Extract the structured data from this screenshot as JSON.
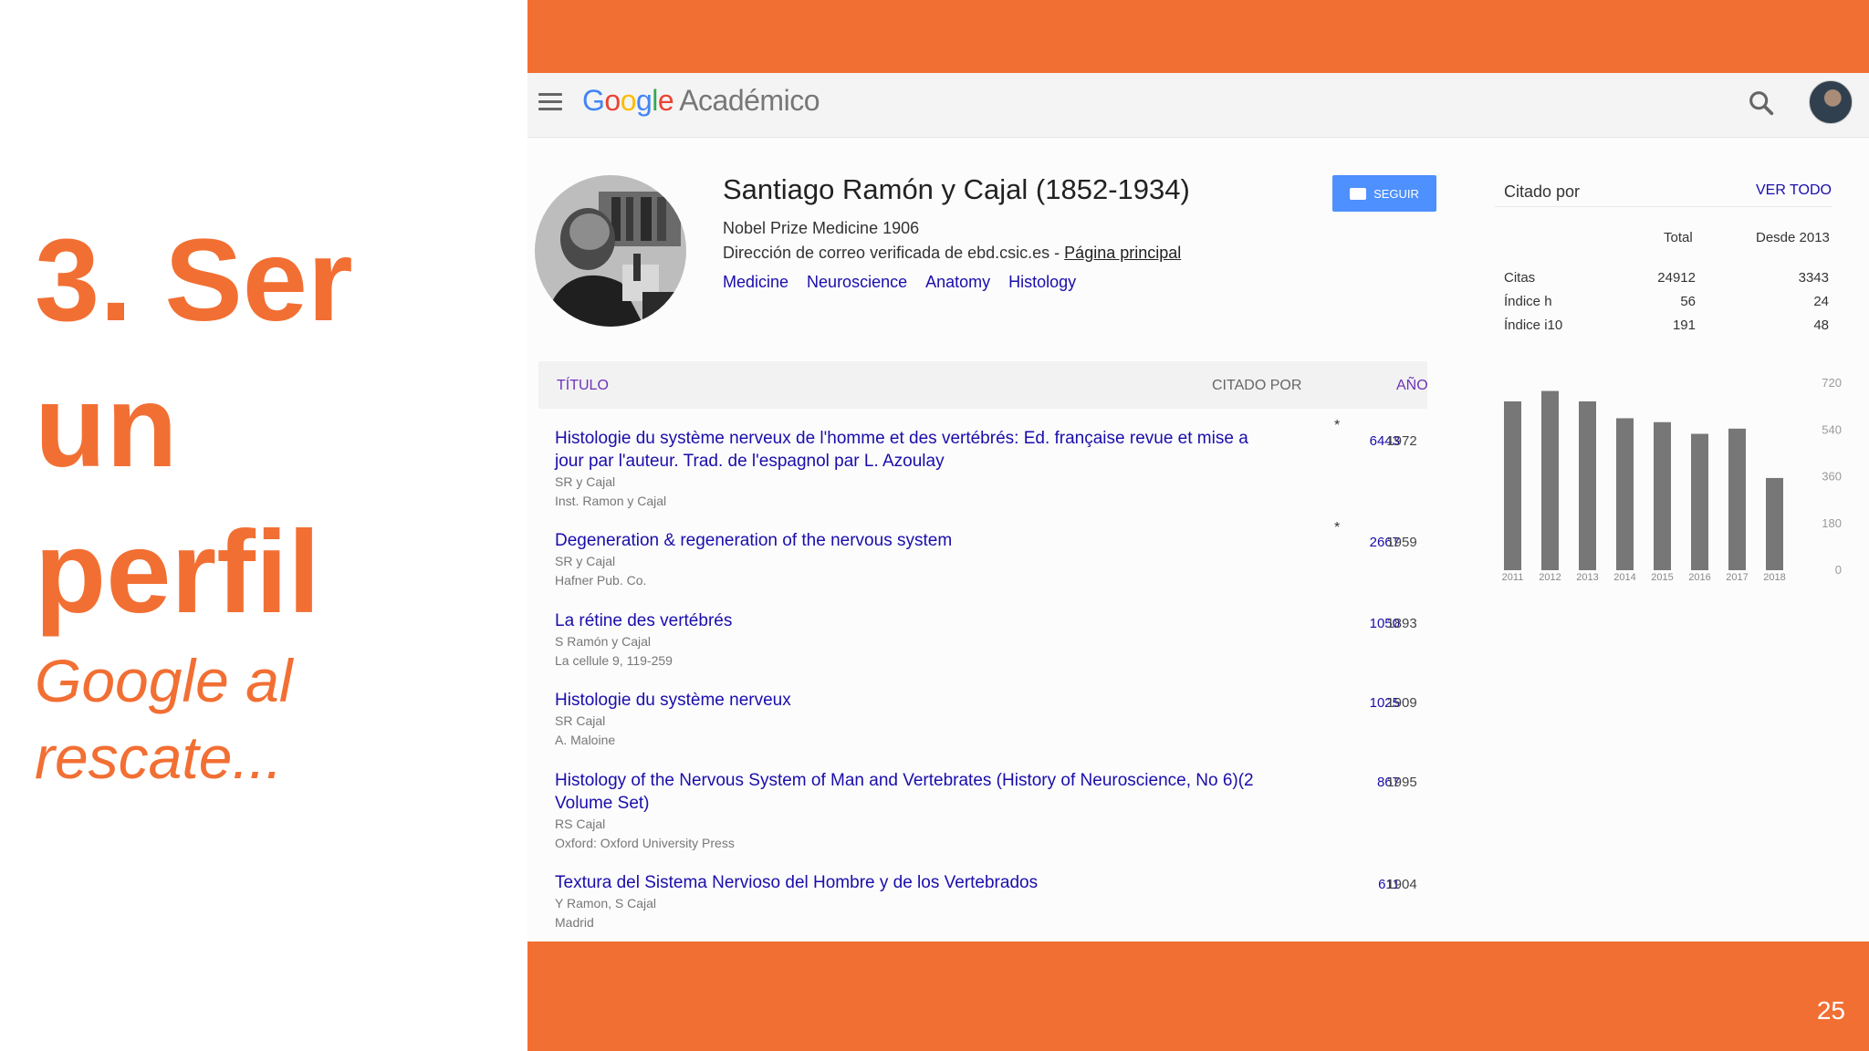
{
  "slide": {
    "title_lines": [
      "3. Ser",
      "un",
      "perfil"
    ],
    "subtitle": "Google al rescate...",
    "page_number": "25",
    "accent_color": "#f26f33"
  },
  "scholar": {
    "logo_google": [
      "G",
      "o",
      "o",
      "g",
      "l",
      "e"
    ],
    "logo_suffix": "Académico",
    "icons": {
      "menu": "menu-icon",
      "search": "search-icon",
      "avatar": "account-avatar"
    },
    "profile": {
      "name": "Santiago Ramón y Cajal (1852-1934)",
      "affiliation": "Nobel Prize Medicine 1906",
      "email_text": "Dirección de correo verificada de ebd.csic.es - ",
      "homepage_link": "Página principal",
      "interests": [
        "Medicine",
        "Neuroscience",
        "Anatomy",
        "Histology"
      ],
      "follow_label": "SEGUIR"
    },
    "table": {
      "col_title": "TÍTULO",
      "col_cited": "CITADO POR",
      "col_year": "AÑO",
      "articles": [
        {
          "title": "Histologie du système nerveux de l'homme et des vertébrés: Ed. française revue et mise a jour par l'auteur. Trad. de l'espagnol par L. Azoulay",
          "authors": "SR y Cajal",
          "venue": "Inst. Ramon y Cajal",
          "cited": "6443",
          "star": "*",
          "year": "1972"
        },
        {
          "title": "Degeneration & regeneration of the nervous system",
          "authors": "SR y Cajal",
          "venue": "Hafner Pub. Co.",
          "cited": "2667",
          "star": "*",
          "year": "1959"
        },
        {
          "title": "La rétine des vertébrés",
          "authors": "S Ramón y Cajal",
          "venue": "La cellule 9, 119-259",
          "cited": "1050",
          "star": "",
          "year": "1893"
        },
        {
          "title": "Histologie du système nerveux",
          "authors": "SR Cajal",
          "venue": "A. Maloine",
          "cited": "1025",
          "star": "",
          "year": "1909"
        },
        {
          "title": "Histology of the Nervous System of Man and Vertebrates (History of Neuroscience, No 6)(2 Volume Set)",
          "authors": "RS Cajal",
          "venue": "Oxford: Oxford University Press",
          "cited": "867",
          "star": "",
          "year": "1995"
        },
        {
          "title": "Textura del Sistema Nervioso del Hombre y de los Vertebrados",
          "authors": "Y Ramon, S Cajal",
          "venue": "Madrid",
          "cited": "611",
          "star": "",
          "year": "1904"
        }
      ]
    },
    "cited_by": {
      "label": "Citado por",
      "view_all": "VER TODO",
      "col_total": "Total",
      "col_since": "Desde 2013",
      "rows": [
        {
          "label": "Citas",
          "total": "24912",
          "since": "3343"
        },
        {
          "label": "Índice h",
          "total": "56",
          "since": "24"
        },
        {
          "label": "Índice i10",
          "total": "191",
          "since": "48"
        }
      ]
    }
  },
  "chart_data": {
    "type": "bar",
    "categories": [
      "2011",
      "2012",
      "2013",
      "2014",
      "2015",
      "2016",
      "2017",
      "2018"
    ],
    "values": [
      650,
      690,
      650,
      585,
      570,
      525,
      545,
      355
    ],
    "ylim": [
      0,
      720
    ],
    "yticks": [
      "720",
      "540",
      "360",
      "180",
      "0"
    ],
    "bar_color": "#777777"
  }
}
